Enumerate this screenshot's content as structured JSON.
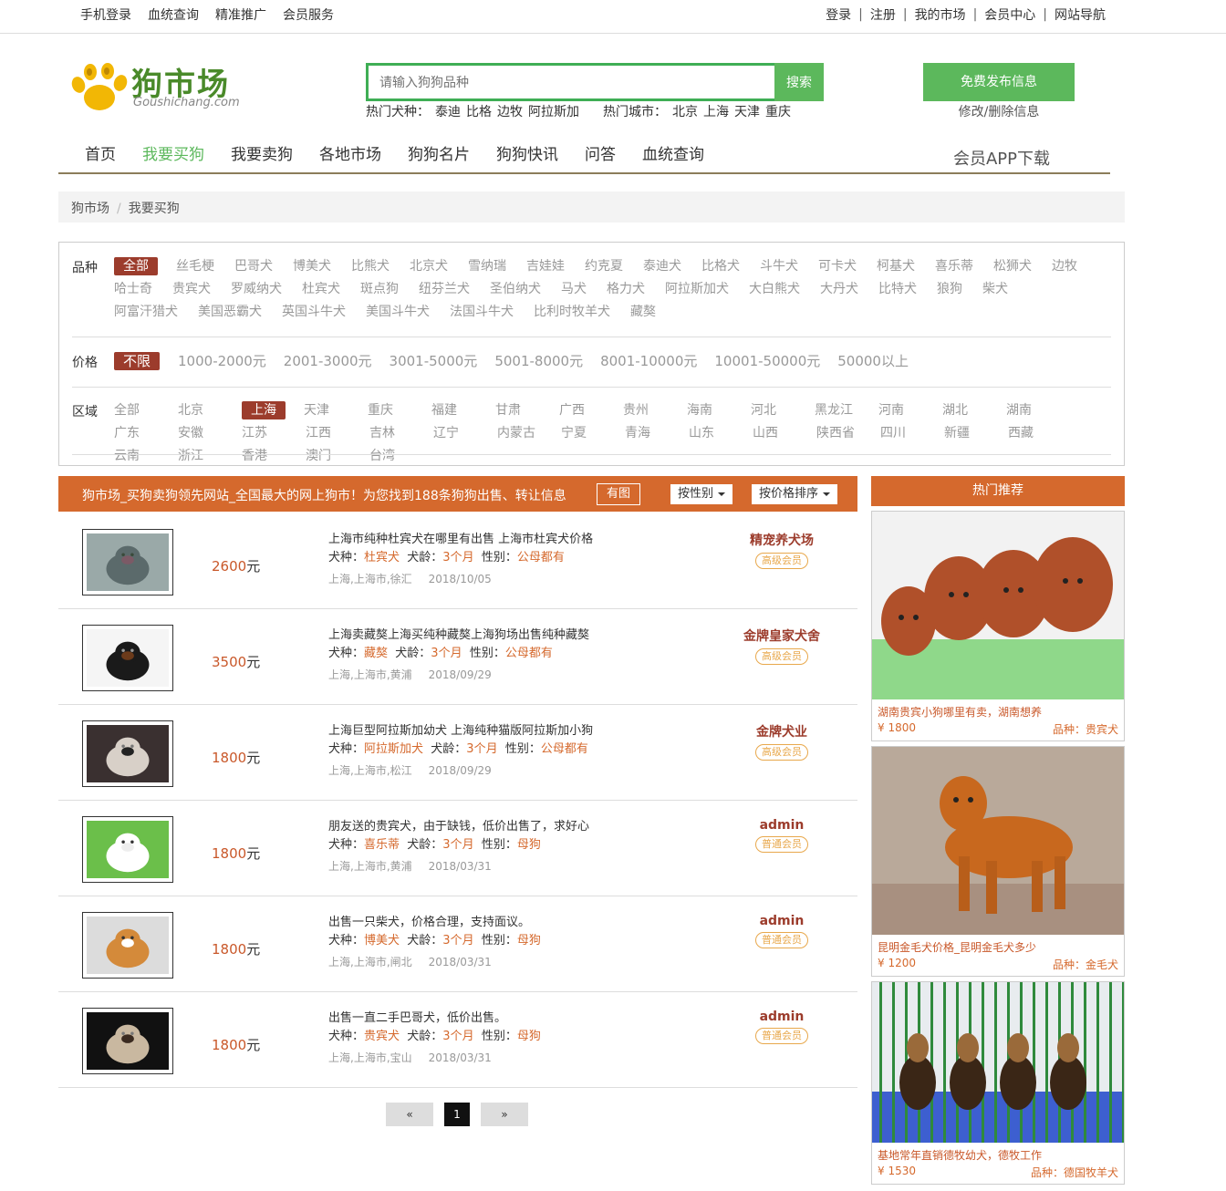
{
  "topbar": {
    "left": [
      "手机登录",
      "血统查询",
      "精准推广",
      "会员服务"
    ],
    "right": [
      "登录",
      "注册",
      "我的市场",
      "会员中心",
      "网站导航"
    ]
  },
  "logo": {
    "title": "狗市场",
    "sub": "Goushichang.com"
  },
  "search": {
    "placeholder": "请输入狗狗品种",
    "button": "搜索"
  },
  "hot": {
    "breeds_label": "热门犬种：",
    "breeds": [
      "泰迪",
      "比格",
      "边牧",
      "阿拉斯加"
    ],
    "cities_label": "热门城市：",
    "cities": [
      "北京",
      "上海",
      "天津",
      "重庆"
    ]
  },
  "publish": {
    "button": "免费发布信息",
    "modify": "修改/删除信息"
  },
  "nav": {
    "items": [
      "首页",
      "我要买狗",
      "我要卖狗",
      "各地市场",
      "狗狗名片",
      "狗狗快讯",
      "问答",
      "血统查询"
    ],
    "active": 1,
    "app": "会员APP下载"
  },
  "breadcrumb": [
    "狗市场",
    "我要买狗"
  ],
  "filters": {
    "breed": {
      "label": "品种",
      "options": [
        "全部",
        "丝毛梗",
        "巴哥犬",
        "博美犬",
        "比熊犬",
        "北京犬",
        "雪纳瑞",
        "吉娃娃",
        "约克夏",
        "泰迪犬",
        "比格犬",
        "斗牛犬",
        "可卡犬",
        "柯基犬",
        "喜乐蒂",
        "松狮犬",
        "边牧",
        "哈士奇",
        "贵宾犬",
        "罗威纳犬",
        "杜宾犬",
        "斑点狗",
        "纽芬兰犬",
        "圣伯纳犬",
        "马犬",
        "格力犬",
        "阿拉斯加犬",
        "大白熊犬",
        "大丹犬",
        "比特犬",
        "狼狗",
        "柴犬",
        "阿富汗猎犬",
        "美国恶霸犬",
        "英国斗牛犬",
        "美国斗牛犬",
        "法国斗牛犬",
        "比利时牧羊犬",
        "藏獒"
      ],
      "selected": 0
    },
    "price": {
      "label": "价格",
      "options": [
        "不限",
        "1000-2000元",
        "2001-3000元",
        "3001-5000元",
        "5001-8000元",
        "8001-10000元",
        "10001-50000元",
        "50000以上"
      ],
      "selected": 0
    },
    "region": {
      "label": "区域",
      "options": [
        "全部",
        "北京",
        "上海",
        "天津",
        "重庆",
        "福建",
        "甘肃",
        "广西",
        "贵州",
        "海南",
        "河北",
        "黑龙江",
        "河南",
        "湖北",
        "湖南",
        "广东",
        "安徽",
        "江苏",
        "江西",
        "吉林",
        "辽宁",
        "内蒙古",
        "宁夏",
        "青海",
        "山东",
        "山西",
        "陕西省",
        "四川",
        "新疆",
        "西藏",
        "云南",
        "浙江",
        "香港",
        "澳门",
        "台湾"
      ],
      "selected": 2
    }
  },
  "listbar": {
    "text": "狗市场_买狗卖狗领先网站_全国最大的网上狗市！为您找到188条狗狗出售、转让信息",
    "has_image": "有图",
    "sort_gender": "按性别",
    "sort_price": "按价格排序"
  },
  "listings": [
    {
      "price": "2600",
      "unit": "元",
      "title": "上海市纯种杜宾犬在哪里有出售 上海市杜宾犬价格",
      "breed": "杜宾犬",
      "age": "3个月",
      "gender": "公母都有",
      "location": "上海,上海市,徐汇",
      "date": "2018/10/05",
      "seller": "精宠养犬场",
      "badge": "高级会员",
      "img": "garden"
    },
    {
      "price": "3500",
      "unit": "元",
      "title": "上海卖藏獒上海买纯种藏獒上海狗场出售纯种藏獒",
      "breed": "藏獒",
      "age": "3个月",
      "gender": "公母都有",
      "location": "上海,上海市,黄浦",
      "date": "2018/09/29",
      "seller": "金牌皇家犬舍",
      "badge": "高级会员",
      "img": "mastiff"
    },
    {
      "price": "1800",
      "unit": "元",
      "title": "上海巨型阿拉斯加幼犬 上海纯种猫版阿拉斯加小狗",
      "breed": "阿拉斯加犬",
      "age": "3个月",
      "gender": "公母都有",
      "location": "上海,上海市,松江",
      "date": "2018/09/29",
      "seller": "金牌犬业",
      "badge": "高级会员",
      "img": "malamute"
    },
    {
      "price": "1800",
      "unit": "元",
      "title": "朋友送的贵宾犬，由于缺钱，低价出售了，求好心",
      "breed": "喜乐蒂",
      "age": "3个月",
      "gender": "母狗",
      "location": "上海,上海市,黄浦",
      "date": "2018/03/31",
      "seller": "admin",
      "badge": "普通会员",
      "img": "pom"
    },
    {
      "price": "1800",
      "unit": "元",
      "title": "出售一只柴犬，价格合理，支持面议。",
      "breed": "博美犬",
      "age": "3个月",
      "gender": "母狗",
      "location": "上海,上海市,闸北",
      "date": "2018/03/31",
      "seller": "admin",
      "badge": "普通会员",
      "img": "shiba"
    },
    {
      "price": "1800",
      "unit": "元",
      "title": "出售一直二手巴哥犬，低价出售。",
      "breed": "贵宾犬",
      "age": "3个月",
      "gender": "母狗",
      "location": "上海,上海市,宝山",
      "date": "2018/03/31",
      "seller": "admin",
      "badge": "普通会员",
      "img": "pug"
    }
  ],
  "labels": {
    "breed": "犬种：",
    "age": "犬龄：",
    "gender": "性别："
  },
  "pager": {
    "prev": "«",
    "current": "1",
    "next": "»"
  },
  "sidebar": {
    "title": "热门推荐",
    "breed_prefix": "品种：",
    "cards": [
      {
        "title": "湖南贵宾小狗哪里有卖，湖南想养",
        "price": "¥ 1800",
        "breed": "贵宾犬",
        "img": "poodles"
      },
      {
        "title": "昆明金毛犬价格_昆明金毛犬多少",
        "price": "¥ 1200",
        "breed": "金毛犬",
        "img": "golden"
      },
      {
        "title": "基地常年直销德牧幼犬，德牧工作",
        "price": "¥ 1530",
        "breed": "德国牧羊犬",
        "img": "shepherds"
      }
    ]
  }
}
